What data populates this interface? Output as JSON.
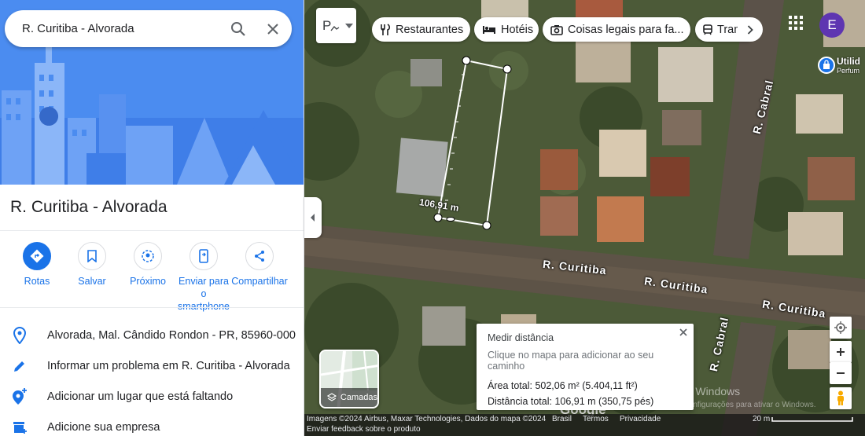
{
  "search": {
    "value": "R. Curitiba - Alvorada"
  },
  "place": {
    "title": "R. Curitiba - Alvorada"
  },
  "actions": [
    {
      "label": "Rotas"
    },
    {
      "label": "Salvar"
    },
    {
      "label": "Próximo"
    },
    {
      "label": "Enviar para o smartphone"
    },
    {
      "label": "Compartilhar"
    }
  ],
  "info": [
    {
      "text": "Alvorada, Mal. Cândido Rondon - PR, 85960-000",
      "icon": "location-pin-icon"
    },
    {
      "text": "Informar um problema em R. Curitiba - Alvorada",
      "icon": "pencil-icon"
    },
    {
      "text": "Adicionar um lugar que está faltando",
      "icon": "add-place-icon"
    },
    {
      "text": "Adicione sua empresa",
      "icon": "storefront-icon"
    }
  ],
  "map_type": {
    "label": "P"
  },
  "chips": [
    {
      "label": "Restaurantes",
      "icon": "fork-knife-icon"
    },
    {
      "label": "Hotéis",
      "icon": "bed-icon"
    },
    {
      "label": "Coisas legais para fa...",
      "icon": "camera-icon"
    },
    {
      "label": "Tran",
      "icon": "transit-icon"
    }
  ],
  "account": {
    "initial": "E",
    "color": "#5e35b1"
  },
  "poi": {
    "line1": "Utilid",
    "line2": "Perfum"
  },
  "streets": {
    "cabral_top": "R. Cabral",
    "cabral_bottom": "R. Cabral",
    "curitiba_1": "R. Curitiba",
    "curitiba_2": "R. Curitiba",
    "curitiba_3": "R. Curitiba"
  },
  "measure_label": "106,91 m",
  "measure_panel": {
    "title": "Medir distância",
    "hint": "Clique no mapa para adicionar ao seu caminho",
    "area": "Área total: 502,06 m² (5.404,11 ft²)",
    "distance": "Distância total: 106,91 m (350,75 pés)"
  },
  "layers": {
    "label": "Camadas"
  },
  "google_logo": "Google",
  "footer": {
    "imagery": "Imagens ©2024 Airbus, Maxar Technologies, Dados do mapa ©2024",
    "feedback": "Enviar feedback sobre o produto",
    "country": "Brasil",
    "terms": "Termos",
    "privacy": "Privacidade",
    "scale": "20 m"
  },
  "watermark": {
    "title": "Ativar o Windows",
    "subtitle": "Acesse Configurações para ativar o Windows."
  },
  "colors": {
    "accent": "#1a73e8",
    "hero": "#4b8cf0"
  }
}
